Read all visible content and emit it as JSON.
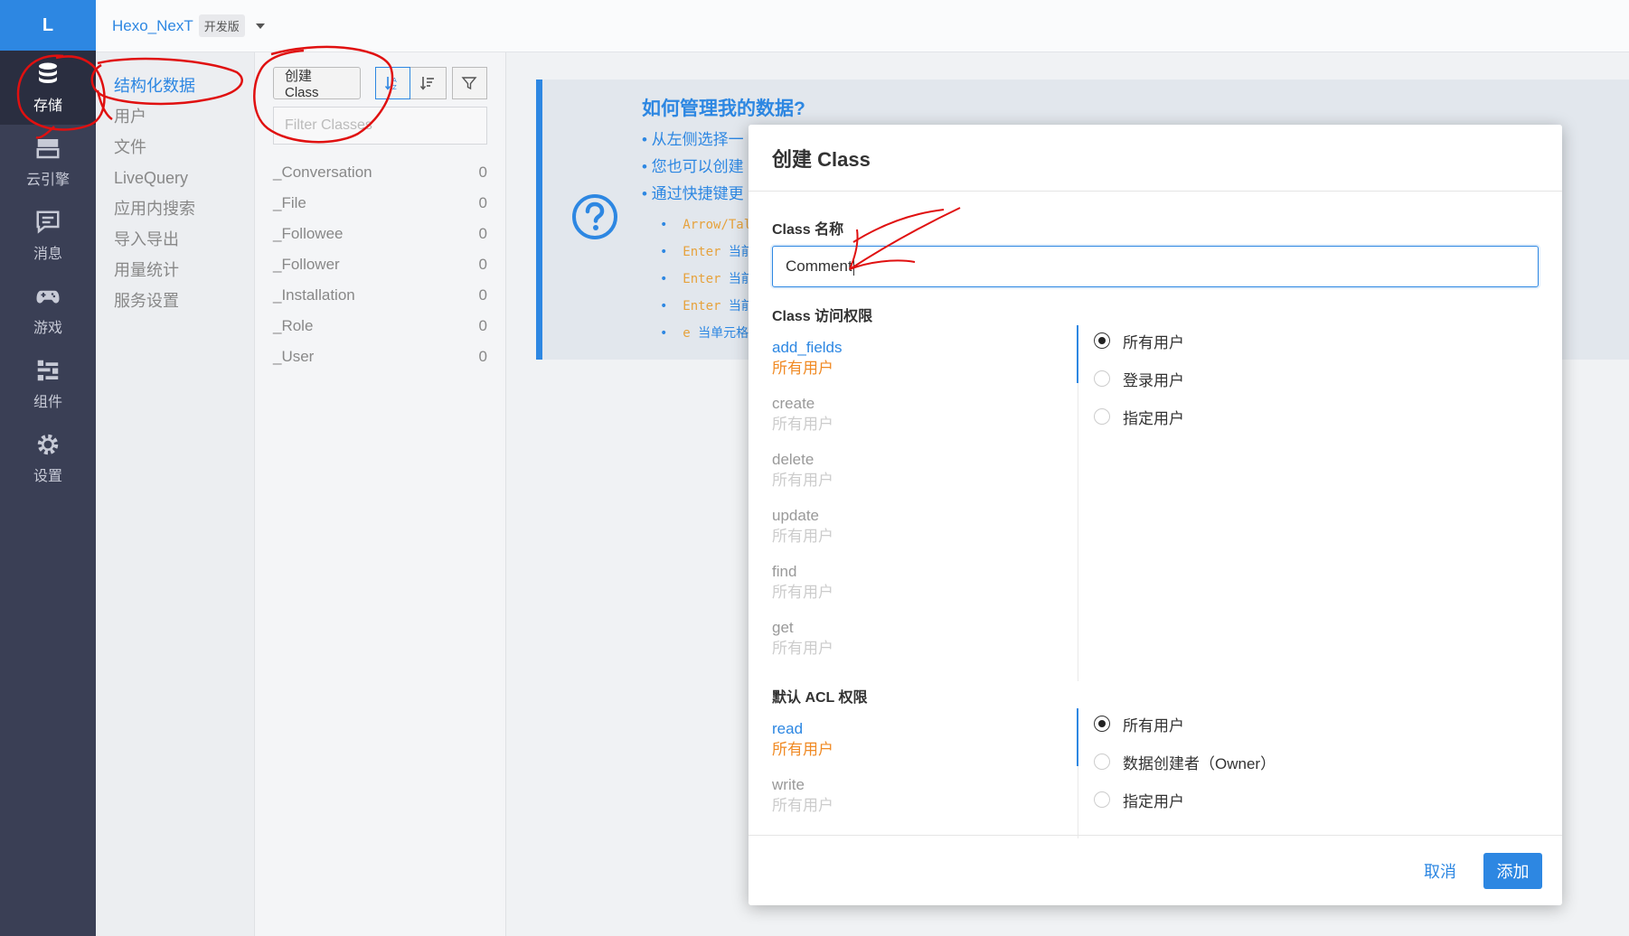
{
  "rail": {
    "logo": "L",
    "items": [
      {
        "label": "存储",
        "icon": "database-icon",
        "active": true
      },
      {
        "label": "云引擎",
        "icon": "server-icon",
        "active": false
      },
      {
        "label": "消息",
        "icon": "message-icon",
        "active": false
      },
      {
        "label": "游戏",
        "icon": "gamepad-icon",
        "active": false
      },
      {
        "label": "组件",
        "icon": "components-icon",
        "active": false
      },
      {
        "label": "设置",
        "icon": "gear-icon",
        "active": false
      }
    ]
  },
  "topbar": {
    "app_name": "Hexo_NexT",
    "env_badge": "开发版"
  },
  "submenu": {
    "items": [
      "结构化数据",
      "用户",
      "文件",
      "LiveQuery",
      "应用内搜索",
      "导入导出",
      "用量统计",
      "服务设置"
    ]
  },
  "classes": {
    "create_label": "创建 Class",
    "filter_placeholder": "Filter Classes",
    "rows": [
      {
        "name": "_Conversation",
        "count": "0"
      },
      {
        "name": "_File",
        "count": "0"
      },
      {
        "name": "_Followee",
        "count": "0"
      },
      {
        "name": "_Follower",
        "count": "0"
      },
      {
        "name": "_Installation",
        "count": "0"
      },
      {
        "name": "_Role",
        "count": "0"
      },
      {
        "name": "_User",
        "count": "0"
      }
    ]
  },
  "help": {
    "title": "如何管理我的数据?",
    "bullets": [
      "• 从左侧选择一",
      "• 您也可以创建",
      "• 通过快捷键更"
    ],
    "shortcuts": [
      {
        "key": "Arrow/Tal",
        "text": ""
      },
      {
        "key": "Enter",
        "text": "当前"
      },
      {
        "key": "Enter",
        "text": "当前"
      },
      {
        "key": "Enter",
        "text": "当前"
      },
      {
        "key": "e",
        "text": "当单元格"
      }
    ]
  },
  "modal": {
    "title": "创建 Class",
    "name_label": "Class 名称",
    "name_value": "Comment",
    "access_label": "Class 访问权限",
    "ops": [
      {
        "op": "add_fields",
        "who": "所有用户",
        "active": true
      },
      {
        "op": "create",
        "who": "所有用户",
        "active": false
      },
      {
        "op": "delete",
        "who": "所有用户",
        "active": false
      },
      {
        "op": "update",
        "who": "所有用户",
        "active": false
      },
      {
        "op": "find",
        "who": "所有用户",
        "active": false
      },
      {
        "op": "get",
        "who": "所有用户",
        "active": false
      }
    ],
    "access_options": [
      {
        "label": "所有用户",
        "checked": true
      },
      {
        "label": "登录用户",
        "checked": false
      },
      {
        "label": "指定用户",
        "checked": false
      }
    ],
    "acl_label": "默认 ACL 权限",
    "acl_ops": [
      {
        "op": "read",
        "who": "所有用户",
        "active": true
      },
      {
        "op": "write",
        "who": "所有用户",
        "active": false
      }
    ],
    "acl_options": [
      {
        "label": "所有用户",
        "checked": true
      },
      {
        "label": "数据创建者（Owner）",
        "checked": false
      },
      {
        "label": "指定用户",
        "checked": false
      }
    ],
    "cancel_label": "取消",
    "add_label": "添加"
  },
  "colors": {
    "accent": "#2d87e2",
    "rail_bg": "#3a3f55",
    "owner_orange": "#f08a24",
    "annotation_red": "#e01010"
  }
}
